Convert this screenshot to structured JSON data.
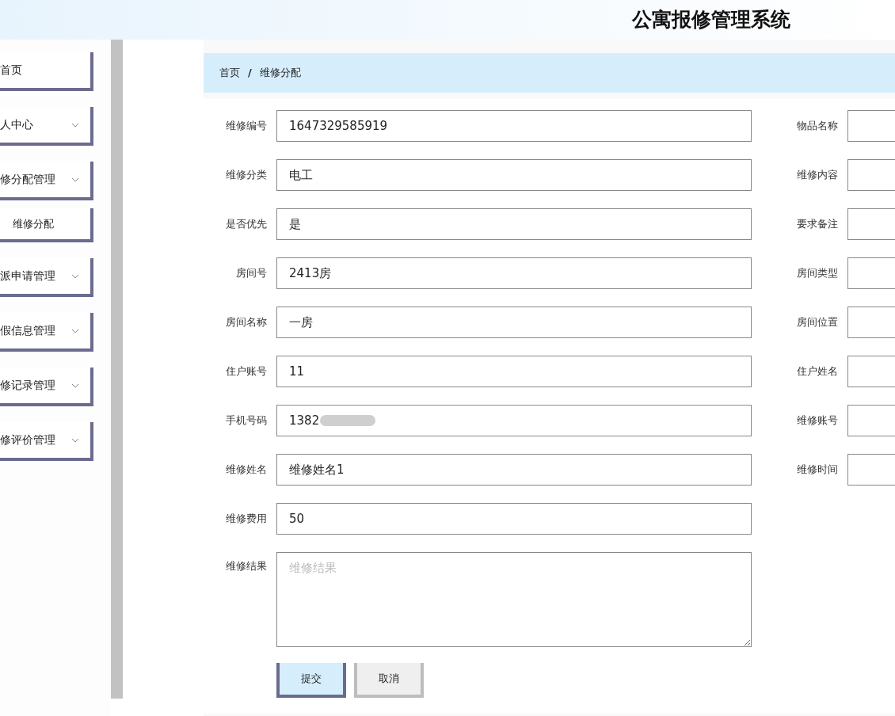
{
  "header": {
    "title": "公寓报修管理系统"
  },
  "sidebar": {
    "items": [
      {
        "label": "首页",
        "has_menu": false
      },
      {
        "label": "人中心",
        "has_menu": true
      },
      {
        "label": "修分配管理",
        "has_menu": true,
        "children": [
          {
            "label": "维修分配"
          }
        ]
      },
      {
        "label": "派申请管理",
        "has_menu": true
      },
      {
        "label": "假信息管理",
        "has_menu": true
      },
      {
        "label": "修记录管理",
        "has_menu": true
      },
      {
        "label": "修评价管理",
        "has_menu": true
      }
    ]
  },
  "breadcrumb": [
    "首页",
    "/",
    "维修分配"
  ],
  "form": {
    "rows": [
      {
        "left": {
          "label": "维修编号",
          "value": "1647329585919"
        },
        "right": {
          "label": "物品名称"
        }
      },
      {
        "left": {
          "label": "维修分类",
          "value": "电工"
        },
        "right": {
          "label": "维修内容"
        }
      },
      {
        "left": {
          "label": "是否优先",
          "value": "是"
        },
        "right": {
          "label": "要求备注"
        }
      },
      {
        "left": {
          "label": "房间号",
          "value": "2413房"
        },
        "right": {
          "label": "房间类型"
        }
      },
      {
        "left": {
          "label": "房间名称",
          "value": "一房"
        },
        "right": {
          "label": "房间位置"
        }
      },
      {
        "left": {
          "label": "住户账号",
          "value": "11"
        },
        "right": {
          "label": "住户姓名"
        }
      },
      {
        "left": {
          "label": "手机号码",
          "value": "1382",
          "blurred": true
        },
        "right": {
          "label": "维修账号"
        }
      },
      {
        "left": {
          "label": "维修姓名",
          "value": "维修姓名1"
        },
        "right": {
          "label": "维修时间"
        }
      },
      {
        "left": {
          "label": "维修费用",
          "value": "50"
        }
      }
    ],
    "result": {
      "label": "维修结果",
      "placeholder": "维修结果"
    },
    "buttons": [
      {
        "label": "提交",
        "kind": "primary"
      },
      {
        "label": "取消",
        "kind": "secondary"
      }
    ]
  }
}
